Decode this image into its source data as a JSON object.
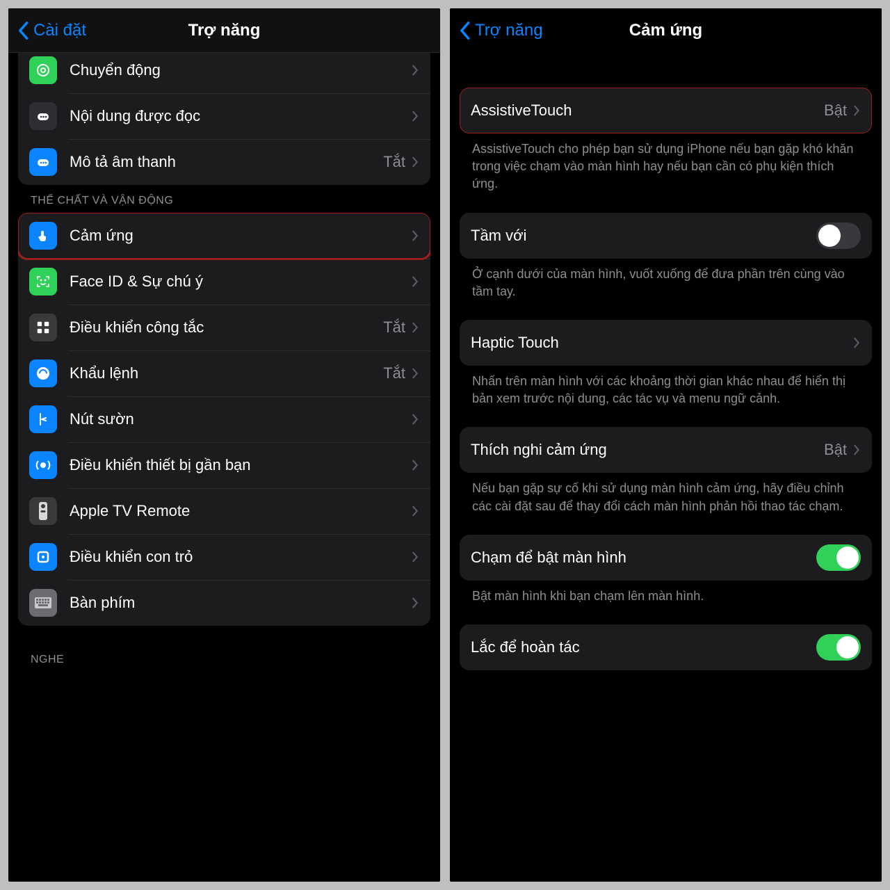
{
  "left": {
    "back": "Cài đặt",
    "title": "Trợ năng",
    "group1": [
      {
        "icon": "motion-icon",
        "bg": "bg-green1",
        "label": "Chuyển động"
      },
      {
        "icon": "spoken-icon",
        "bg": "bg-black",
        "label": "Nội dung được đọc"
      },
      {
        "icon": "audio-desc-icon",
        "bg": "bg-blue",
        "label": "Mô tả âm thanh",
        "value": "Tắt"
      }
    ],
    "section2_header": "THỂ CHẤT VÀ VẬN ĐỘNG",
    "group2": [
      {
        "icon": "touch-icon",
        "bg": "bg-blue",
        "label": "Cảm ứng",
        "hl": true
      },
      {
        "icon": "faceid-icon",
        "bg": "bg-green2",
        "label": "Face ID & Sự chú ý"
      },
      {
        "icon": "switch-icon",
        "bg": "bg-gray",
        "label": "Điều khiển công tắc",
        "value": "Tắt"
      },
      {
        "icon": "voice-icon",
        "bg": "bg-blue",
        "label": "Khẩu lệnh",
        "value": "Tắt"
      },
      {
        "icon": "side-button-icon",
        "bg": "bg-blue",
        "label": "Nút sườn"
      },
      {
        "icon": "nearby-icon",
        "bg": "bg-blue",
        "label": "Điều khiển thiết bị gần bạn"
      },
      {
        "icon": "tv-remote-icon",
        "bg": "bg-gray",
        "label": "Apple TV Remote"
      },
      {
        "icon": "pointer-icon",
        "bg": "bg-blue",
        "label": "Điều khiển con trỏ"
      },
      {
        "icon": "keyboard-icon",
        "bg": "bg-gray2",
        "label": "Bàn phím"
      }
    ],
    "section3_header": "NGHE"
  },
  "right": {
    "back": "Trợ năng",
    "title": "Cảm ứng",
    "g1": {
      "label": "AssistiveTouch",
      "value": "Bật"
    },
    "g1_foot": "AssistiveTouch cho phép bạn sử dụng iPhone nếu bạn gặp khó khăn trong việc chạm vào màn hình hay nếu bạn cần có phụ kiện thích ứng.",
    "g2": {
      "label": "Tầm với"
    },
    "g2_foot": "Ở cạnh dưới của màn hình, vuốt xuống để đưa phần trên cùng vào tầm tay.",
    "g3": {
      "label": "Haptic Touch"
    },
    "g3_foot": "Nhấn trên màn hình với các khoảng thời gian khác nhau để hiển thị bản xem trước nội dung, các tác vụ và menu ngữ cảnh.",
    "g4": {
      "label": "Thích nghi cảm ứng",
      "value": "Bật"
    },
    "g4_foot": "Nếu bạn gặp sự cố khi sử dụng màn hình cảm ứng, hãy điều chỉnh các cài đặt sau để thay đổi cách màn hình phản hồi thao tác chạm.",
    "g5": {
      "label": "Chạm để bật màn hình"
    },
    "g5_foot": "Bật màn hình khi bạn chạm lên màn hình.",
    "g6": {
      "label": "Lắc để hoàn tác"
    }
  }
}
